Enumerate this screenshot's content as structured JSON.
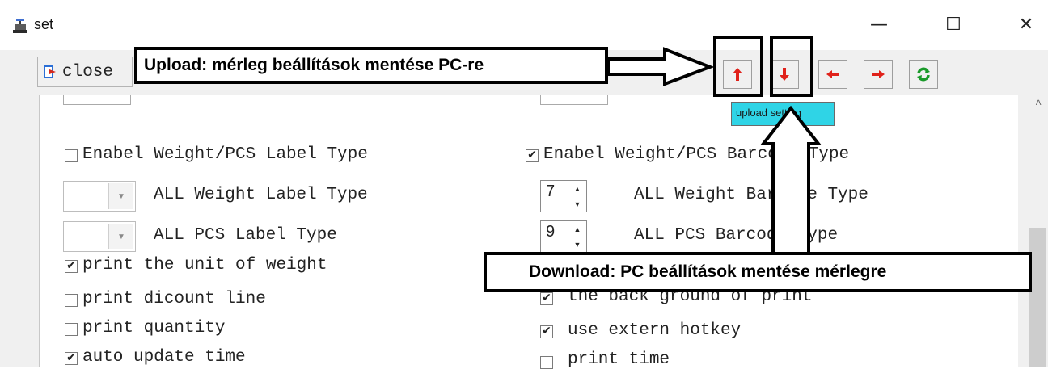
{
  "window": {
    "title": "set",
    "minimize_glyph": "—",
    "maximize_glyph": "☐",
    "close_glyph": "✕"
  },
  "toolbar": {
    "close_label": "close",
    "buttons": [
      {
        "name": "upload-setting-button",
        "icon": "arrow-up-icon"
      },
      {
        "name": "download-setting-button",
        "icon": "arrow-down-icon"
      },
      {
        "name": "previous-button",
        "icon": "arrow-left-icon"
      },
      {
        "name": "next-button",
        "icon": "arrow-right-icon"
      },
      {
        "name": "refresh-button",
        "icon": "refresh-icon"
      }
    ],
    "tooltip": "upload setting"
  },
  "left_options": {
    "enable_label_type": {
      "label": "Enabel Weight/PCS Label Type",
      "checked": false
    },
    "weight_label": {
      "label": "ALL Weight Label Type",
      "value": ""
    },
    "pcs_label": {
      "label": "ALL PCS Label Type",
      "value": ""
    },
    "checks": [
      {
        "label": "print the unit of weight",
        "checked": true
      },
      {
        "label": "print dicount line",
        "checked": false
      },
      {
        "label": "print quantity",
        "checked": false
      },
      {
        "label": "auto update time",
        "checked": true
      }
    ]
  },
  "right_options": {
    "enable_barcode_type": {
      "label": "Enabel Weight/PCS Barcode Type",
      "checked": true
    },
    "weight_barcode": {
      "label": "ALL Weight Barcode Type",
      "value": "7"
    },
    "pcs_barcode": {
      "label": "ALL PCS Barcode Type",
      "value": "9"
    },
    "checks": [
      {
        "label": "the back ground of print",
        "checked": true
      },
      {
        "label": "use extern hotkey",
        "checked": true
      },
      {
        "label": "print time",
        "checked": false
      }
    ]
  },
  "annotations": {
    "upload": "Upload: mérleg beállítások mentése PC-re",
    "download": "Download: PC beállítások mentése mérlegre"
  },
  "colors": {
    "arrow_red": "#e0211a",
    "refresh_green": "#1a9a2a",
    "tooltip_bg": "#2fd4e6"
  }
}
